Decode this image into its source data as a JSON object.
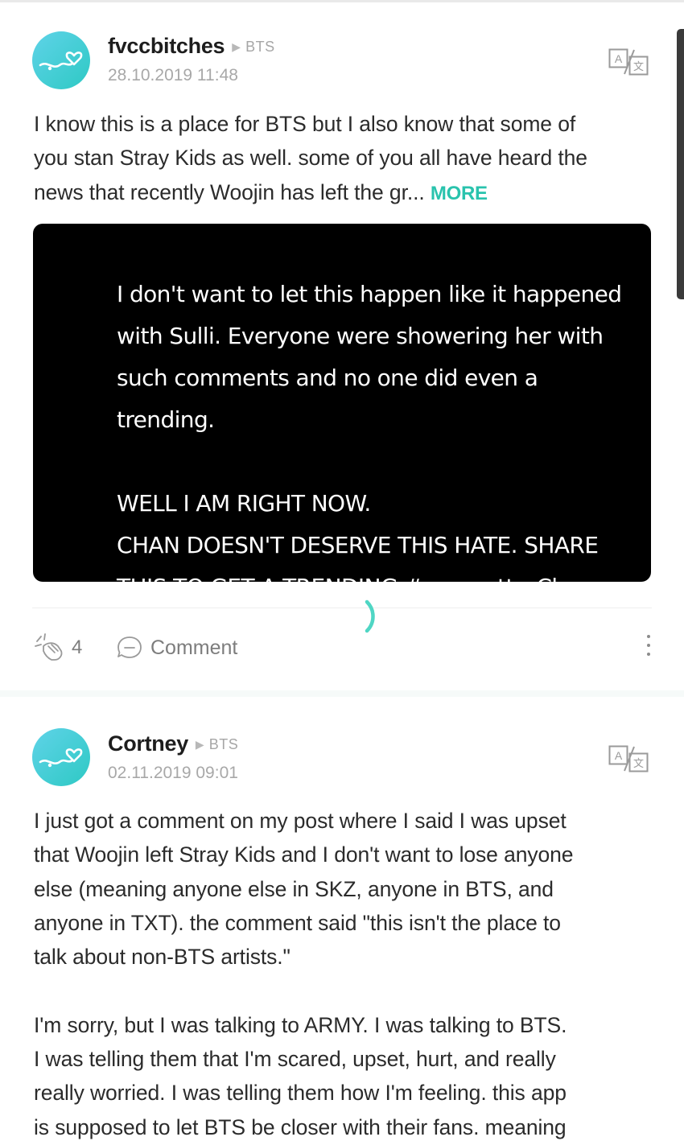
{
  "posts": [
    {
      "username": "fvccbitches",
      "community": "BTS",
      "timestamp": "28.10.2019 11:48",
      "body_lines": [
        "I know this is a place for BTS but I also know that some of",
        "you stan Stray Kids as well. some of you all have heard the",
        "news that recently Woojin has left the gr..."
      ],
      "more_label": "MORE",
      "media_lines": [
        "I don't want to let this happen like it happened",
        "with Sulli. Everyone were showering her with",
        "such comments and no one did even a",
        "trending.",
        "",
        "WELL I AM RIGHT NOW.",
        "CHAN DOESN'T DESERVE THIS HATE. SHARE",
        "THIS TO GET A TRENDING #youmatterChan"
      ],
      "applause_count": "4",
      "comment_label": "Comment"
    },
    {
      "username": "Cortney",
      "community": "BTS",
      "timestamp": "02.11.2019 09:01",
      "body_lines": [
        "I just got a comment on my post where I said I was upset",
        "that Woojin left Stray Kids and I don't want to lose anyone",
        "else (meaning anyone else in SKZ, anyone in BTS, and",
        "anyone in TXT). the comment said \"this isn't the place to",
        "talk about non-BTS artists.\"",
        "",
        "I'm sorry, but I was talking to ARMY. I was talking to BTS.",
        "I was telling them that I'm scared, upset, hurt, and really",
        "really worried. I was telling them how I'm feeling. this app",
        "is supposed to let BTS be closer with their fans. meaning"
      ]
    }
  ],
  "icons": {
    "avatar": "avatar-heart-logo",
    "translate": "translate-icon",
    "applause": "applause-icon",
    "comment": "comment-icon",
    "more_menu": "vertical-dots-icon",
    "loader": "loading-spinner-icon"
  },
  "colors": {
    "accent": "#29c3ad",
    "avatar_gradient_start": "#5fd3e8",
    "avatar_gradient_end": "#2ec9c4",
    "media_background": "#000000"
  }
}
